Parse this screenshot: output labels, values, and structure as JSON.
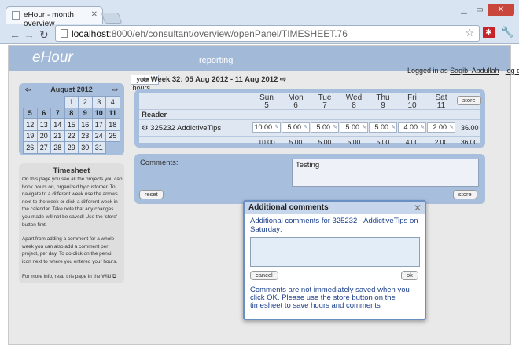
{
  "browser": {
    "tab_title": "eHour - month overview",
    "url_host": "localhost",
    "url_path": ":8000/eh/consultant/overview/openPanel/TIMESHEET.76"
  },
  "app": {
    "logo": "eHour",
    "menu": {
      "your_hours": "your hours ▾",
      "reporting": "reporting"
    },
    "logged_in_label": "Logged in as",
    "user": "Saqib, Abdullah",
    "separator": "-",
    "logoff": "log off"
  },
  "calendar": {
    "month": "August 2012",
    "rows": [
      [
        "",
        "",
        "1",
        "2",
        "3",
        "4"
      ],
      [
        "5",
        "6",
        "7",
        "8",
        "9",
        "10",
        "11"
      ],
      [
        "12",
        "13",
        "14",
        "15",
        "16",
        "17",
        "18"
      ],
      [
        "19",
        "20",
        "21",
        "22",
        "23",
        "24",
        "25"
      ],
      [
        "26",
        "27",
        "28",
        "29",
        "30",
        "31",
        ""
      ]
    ]
  },
  "help": {
    "title": "Timesheet",
    "p1": "On this page you see all the projects you can book hours on, organized by customer. To navigate to a different week use the arrows next to the week or click a different week in the calendar. Take note that any changes you made will not be saved! Use the 'store' button first.",
    "p2": "Apart from adding a comment for a whole week you can also add a comment per project, per day. To do click on the pencil icon next to where you entered your hours.",
    "p3_prefix": "For more info, read this page in",
    "wiki_link": "the Wiki"
  },
  "week": {
    "label": "Week 32: 05 Aug 2012 - 11 Aug 2012"
  },
  "timesheet": {
    "days": [
      {
        "name": "Sun",
        "num": "5"
      },
      {
        "name": "Mon",
        "num": "6"
      },
      {
        "name": "Tue",
        "num": "7"
      },
      {
        "name": "Wed",
        "num": "8"
      },
      {
        "name": "Thu",
        "num": "9"
      },
      {
        "name": "Fri",
        "num": "10"
      },
      {
        "name": "Sat",
        "num": "11"
      }
    ],
    "store_label": "store",
    "customer": "Reader",
    "project": "325232  AddictiveTips",
    "hours": [
      "10.00",
      "5.00",
      "5.00",
      "5.00",
      "5.00",
      "4.00",
      "2.00"
    ],
    "row_total": "36.00",
    "col_totals": [
      "10.00",
      "5.00",
      "5.00",
      "5.00",
      "5.00",
      "4.00",
      "2.00"
    ],
    "grand_total": "36.00"
  },
  "comments": {
    "label": "Comments:",
    "value": "Testing",
    "reset_label": "reset",
    "store_label": "store"
  },
  "dialog": {
    "title": "Additional comments",
    "message": "Additional comments for 325232 - AddictiveTips on Saturday:",
    "cancel_label": "cancel",
    "ok_label": "ok",
    "note": "Comments are not immediately saved when you click OK. Please use the store button on the timesheet to save hours and comments"
  }
}
